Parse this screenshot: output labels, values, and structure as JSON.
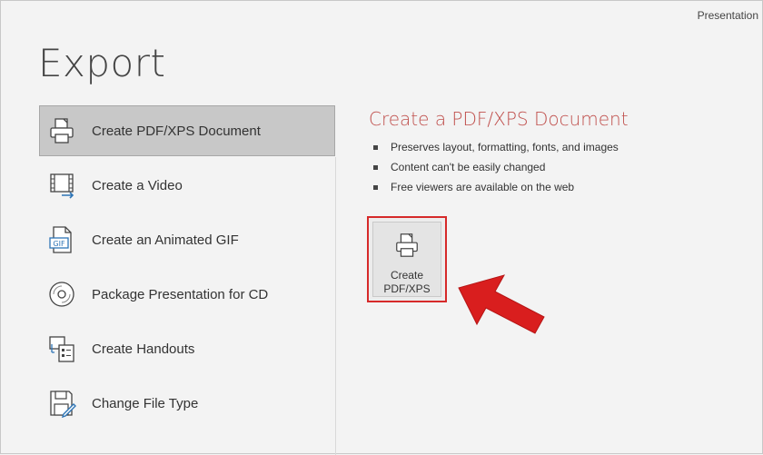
{
  "app": {
    "title": "Presentation"
  },
  "page": {
    "title": "Export"
  },
  "options": [
    {
      "label": "Create PDF/XPS Document",
      "icon": "pdf-document-icon",
      "selected": true
    },
    {
      "label": "Create a Video",
      "icon": "video-icon",
      "selected": false
    },
    {
      "label": "Create an Animated GIF",
      "icon": "gif-icon",
      "selected": false
    },
    {
      "label": "Package Presentation for CD",
      "icon": "cd-icon",
      "selected": false
    },
    {
      "label": "Create Handouts",
      "icon": "handouts-icon",
      "selected": false
    },
    {
      "label": "Change File Type",
      "icon": "change-file-type-icon",
      "selected": false
    }
  ],
  "detail": {
    "title": "Create a PDF/XPS Document",
    "bullets": [
      "Preserves layout, formatting, fonts, and images",
      "Content can't be easily changed",
      "Free viewers are available on the web"
    ],
    "button": {
      "line1": "Create",
      "line2": "PDF/XPS"
    }
  },
  "colors": {
    "accent": "#c0504d",
    "highlight_border": "#d62929",
    "selected_bg": "#c8c8c8",
    "arrow": "#d91e1e"
  }
}
